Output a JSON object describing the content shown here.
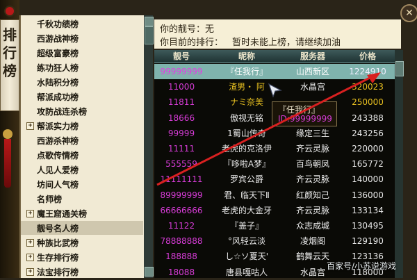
{
  "banner": {
    "title_chars": [
      "排",
      "行",
      "榜"
    ]
  },
  "left_list": {
    "items": [
      {
        "label": "千秋功绩榜",
        "expandable": false,
        "selected": false
      },
      {
        "label": "西游战神榜",
        "expandable": false,
        "selected": false
      },
      {
        "label": "超级富豪榜",
        "expandable": false,
        "selected": false
      },
      {
        "label": "练功狂人榜",
        "expandable": false,
        "selected": false
      },
      {
        "label": "水陆积分榜",
        "expandable": false,
        "selected": false
      },
      {
        "label": "帮派成功榜",
        "expandable": false,
        "selected": false
      },
      {
        "label": "攻防战连杀榜",
        "expandable": false,
        "selected": false
      },
      {
        "label": "帮派实力榜",
        "expandable": true,
        "selected": false
      },
      {
        "label": "西游杀神榜",
        "expandable": false,
        "selected": false
      },
      {
        "label": "点歌传情榜",
        "expandable": false,
        "selected": false
      },
      {
        "label": "人见人爱榜",
        "expandable": false,
        "selected": false
      },
      {
        "label": "坊间人气榜",
        "expandable": false,
        "selected": false
      },
      {
        "label": "名师榜",
        "expandable": false,
        "selected": false
      },
      {
        "label": "魔王窟通关榜",
        "expandable": true,
        "selected": false
      },
      {
        "label": "靓号名人榜",
        "expandable": false,
        "selected": true
      },
      {
        "label": "种族比武榜",
        "expandable": true,
        "selected": false
      },
      {
        "label": "生存排行榜",
        "expandable": true,
        "selected": false
      },
      {
        "label": "法宝排行榜",
        "expandable": true,
        "selected": false
      }
    ]
  },
  "info": {
    "my_number_label": "你的靓号：无",
    "my_rank_label": "你目前的排行：",
    "rank_message": "暂时未能上榜，请继续加油"
  },
  "table": {
    "columns": [
      "靓号",
      "昵称",
      "服务器",
      "价格"
    ],
    "rows": [
      {
        "id": "99999999",
        "name": "『任我行』",
        "server": "山西新区",
        "price": "1224910",
        "highlight": true
      },
      {
        "id": "11000",
        "name": "渣男・ 阿",
        "server": "水晶宫",
        "price": "320023",
        "gold": true
      },
      {
        "id": "11811",
        "name": "ナミ奈美",
        "server": "",
        "price": "250000",
        "gold": true
      },
      {
        "id": "18666",
        "name": "傲视无铭",
        "server": "",
        "price": "243388"
      },
      {
        "id": "99999",
        "name": "1蜀山传奇",
        "server": "缘定三生",
        "price": "243256"
      },
      {
        "id": "11111",
        "name": "老虎的克洛伊",
        "server": "齐云灵脉",
        "price": "220000"
      },
      {
        "id": "555559",
        "name": "『哆啦A梦』",
        "server": "百鸟朝凤",
        "price": "165772"
      },
      {
        "id": "11111111",
        "name": "罗宾公爵",
        "server": "齐云灵脉",
        "price": "140000"
      },
      {
        "id": "89999999",
        "name": "君、临天下Ⅱ",
        "server": "红颜知己",
        "price": "136000"
      },
      {
        "id": "66666666",
        "name": "老虎的大金牙",
        "server": "齐云灵脉",
        "price": "133134"
      },
      {
        "id": "11122",
        "name": "『盖子』",
        "server": "众志成城",
        "price": "130495"
      },
      {
        "id": "78888888",
        "name": "°风轻云淡",
        "server": "凌烟阁",
        "price": "129190"
      },
      {
        "id": "188888",
        "name": "し☆ソ夏天'",
        "server": "鹤舞云天",
        "price": "123136"
      },
      {
        "id": "18088",
        "name": "唐县嘎咕人",
        "server": "水晶宫",
        "price": "118000"
      }
    ]
  },
  "tooltip": {
    "title": "『任我行』",
    "id_line": "ID:99999999"
  },
  "watermark": "百家号/小苏说游戏",
  "close_button": "✕",
  "colors": {
    "highlight_row": "#7fb3ad",
    "id_purple": "#d83cd8",
    "gold_text": "#e8c020",
    "arrow_red": "#d82020"
  }
}
